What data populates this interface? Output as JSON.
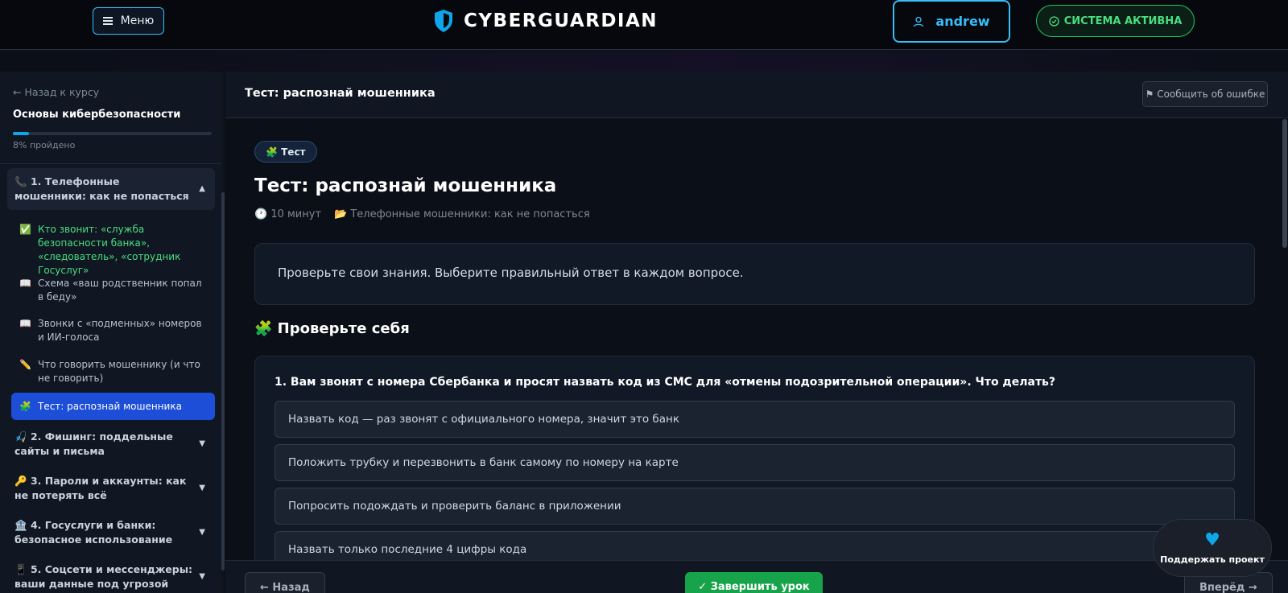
{
  "header": {
    "menu_label": "Меню",
    "brand": "CYBERGUARDIAN",
    "user_name": "andrew",
    "status": "СИСТЕМА АКТИВНА",
    "accent": "#38bdf8",
    "status_color": "#4ade80"
  },
  "sidebar": {
    "back_link": "← Назад к курсу",
    "course_title": "Основы кибербезопасности",
    "progress_percent": 8,
    "progress_text": "8% пройдено",
    "modules": [
      {
        "icon": "📞",
        "title": "1. Телефонные мошенники: как не попасться",
        "expanded": true,
        "lessons": [
          {
            "icon": "✅",
            "title": "Кто звонит: «служба безопасности банка», «следователь», «сотрудник Госуслуг»",
            "state": "done"
          },
          {
            "icon": "📖",
            "title": "Схема «ваш родственник попал в беду»",
            "state": "normal"
          },
          {
            "icon": "📖",
            "title": "Звонки с «подменных» номеров и ИИ-голоса",
            "state": "normal"
          },
          {
            "icon": "✏️",
            "title": "Что говорить мошеннику (и что не говорить)",
            "state": "normal"
          },
          {
            "icon": "🧩",
            "title": "Тест: распознай мошенника",
            "state": "active"
          }
        ]
      },
      {
        "icon": "🎣",
        "title": "2. Фишинг: поддельные сайты и письма",
        "expanded": false
      },
      {
        "icon": "🔑",
        "title": "3. Пароли и аккаунты: как не потерять всё",
        "expanded": false
      },
      {
        "icon": "🏦",
        "title": "4. Госуслуги и банки: безопасное использование",
        "expanded": false
      },
      {
        "icon": "📱",
        "title": "5. Соцсети и мессенджеры: ваши данные под угрозой",
        "expanded": false
      }
    ]
  },
  "main": {
    "header_title": "Тест: распознай мошенника",
    "report_button": "⚑ Сообщить об ошибке",
    "type_badge": "🧩 Тест",
    "lesson_title": "Тест: распознай мошенника",
    "duration": "🕐 10 минут",
    "module_ref": "📂 Телефонные мошенники: как не попасться",
    "intro": "Проверьте свои знания. Выберите правильный ответ в каждом вопросе.",
    "section_title": "🧩 Проверьте себя",
    "question": {
      "text": "1. Вам звонят с номера Сбербанка и просят назвать код из СМС для «отмены подозрительной операции». Что делать?",
      "options": [
        "Назвать код — раз звонят с официального номера, значит это банк",
        "Положить трубку и перезвонить в банк самому по номеру на карте",
        "Попросить подождать и проверить баланс в приложении",
        "Назвать только последние 4 цифры кода"
      ]
    }
  },
  "footer": {
    "prev_label": "← Назад",
    "complete_label": "✓ Завершить урок",
    "next_label": "Вперёд →"
  },
  "support": {
    "label": "Поддержать проект",
    "icon": "heart-icon"
  }
}
